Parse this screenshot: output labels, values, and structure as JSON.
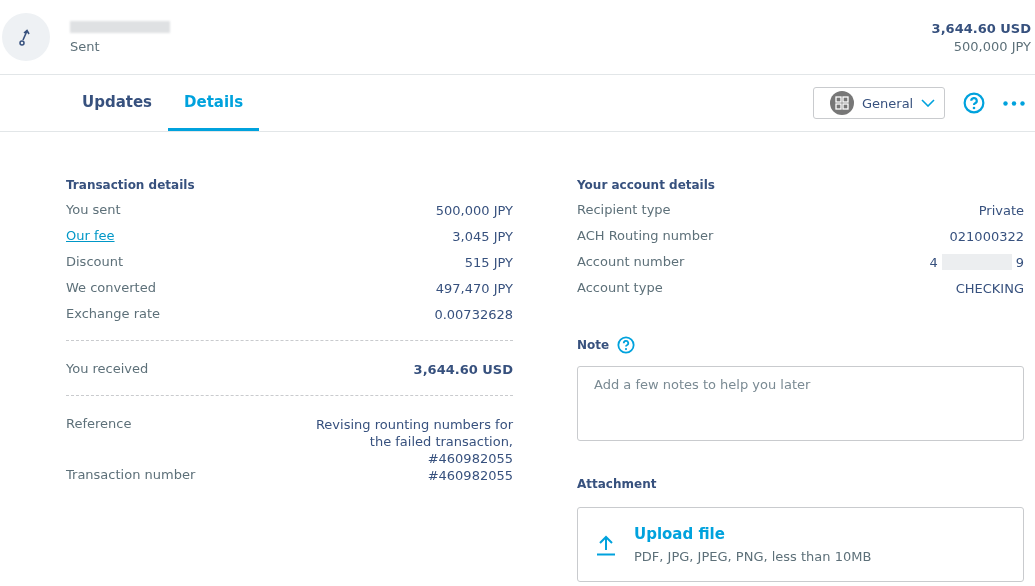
{
  "header": {
    "redacted_name": true,
    "status": "Sent",
    "amount": "3,644.60 USD",
    "amount_secondary": "500,000 JPY"
  },
  "tabs": [
    {
      "label": "Updates",
      "selected": false
    },
    {
      "label": "Details",
      "selected": true
    }
  ],
  "toolbar": {
    "view": "General"
  },
  "transaction": {
    "title": "Transaction details",
    "groups": [
      [
        {
          "label": "You sent",
          "value": "500,000 JPY",
          "link": false,
          "emphasis": false
        },
        {
          "label": "Our fee",
          "value": "3,045 JPY",
          "link": true,
          "emphasis": false
        },
        {
          "label": "Discount",
          "value": "515 JPY",
          "link": false,
          "emphasis": false
        },
        {
          "label": "We converted",
          "value": "497,470 JPY",
          "link": false,
          "emphasis": false
        },
        {
          "label": "Exchange rate",
          "value": "0.00732628",
          "link": false,
          "emphasis": false
        }
      ],
      [
        {
          "label": "You received",
          "value": "3,644.60 USD",
          "link": false,
          "emphasis": true
        }
      ],
      [
        {
          "label": "Reference",
          "value": "Revising rounting numbers for the failed transaction, #460982055",
          "link": false,
          "emphasis": false
        },
        {
          "label": "Transaction number",
          "value": "#460982055",
          "link": false,
          "emphasis": false
        }
      ]
    ]
  },
  "account": {
    "title": "Your account details",
    "rows": [
      {
        "label": "Recipient type",
        "value": "Private",
        "redacted": false
      },
      {
        "label": "ACH Routing number",
        "value": "021000322",
        "redacted": false
      },
      {
        "label": "Account number",
        "value": "4",
        "value_end": "9",
        "redacted": true
      },
      {
        "label": "Account type",
        "value": "CHECKING",
        "redacted": false
      }
    ]
  },
  "note": {
    "label": "Note",
    "placeholder": "Add a few notes to help you later"
  },
  "attachment": {
    "label": "Attachment",
    "upload": {
      "title": "Upload file",
      "hint": "PDF, JPG, JPEG, PNG, less than 10MB"
    }
  }
}
